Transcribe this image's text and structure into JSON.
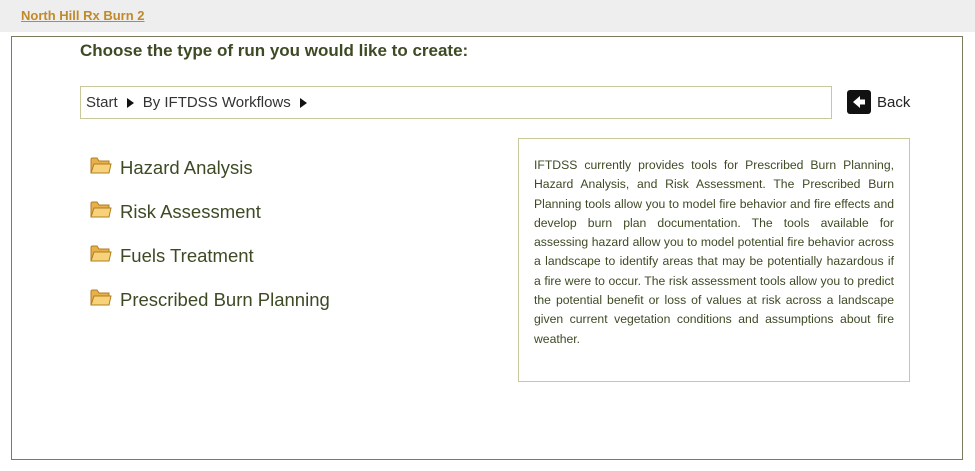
{
  "header": {
    "project_name": "North Hill Rx Burn 2"
  },
  "main": {
    "heading": "Choose the type of run you would like to create:",
    "breadcrumb": [
      {
        "label": "Start"
      },
      {
        "label": "By IFTDSS Workflows"
      }
    ],
    "back_label": "Back",
    "folders": [
      {
        "label": "Hazard Analysis"
      },
      {
        "label": "Risk Assessment"
      },
      {
        "label": "Fuels Treatment"
      },
      {
        "label": "Prescribed Burn Planning"
      }
    ],
    "info_text": "IFTDSS currently provides tools for Prescribed Burn Planning, Hazard Analysis, and Risk Assessment. The Prescribed Burn Planning tools allow you to model fire behavior and fire effects and develop burn plan documentation. The tools available for assessing hazard allow you to model potential fire behavior across a landscape to identify areas that may be potentially hazardous if a fire were to occur. The risk assessment tools allow you to predict the potential benefit or loss of values at risk across a landscape given current vegetation conditions and assumptions about fire weather."
  },
  "icons": {
    "folder": "folder-icon",
    "back": "back-arrow-icon",
    "breadcrumb_separator": "triangle-right-icon"
  },
  "colors": {
    "link": "#c08a2a",
    "heading": "#3d4a24",
    "border": "#c8c89a",
    "topbar": "#eeeeee"
  }
}
